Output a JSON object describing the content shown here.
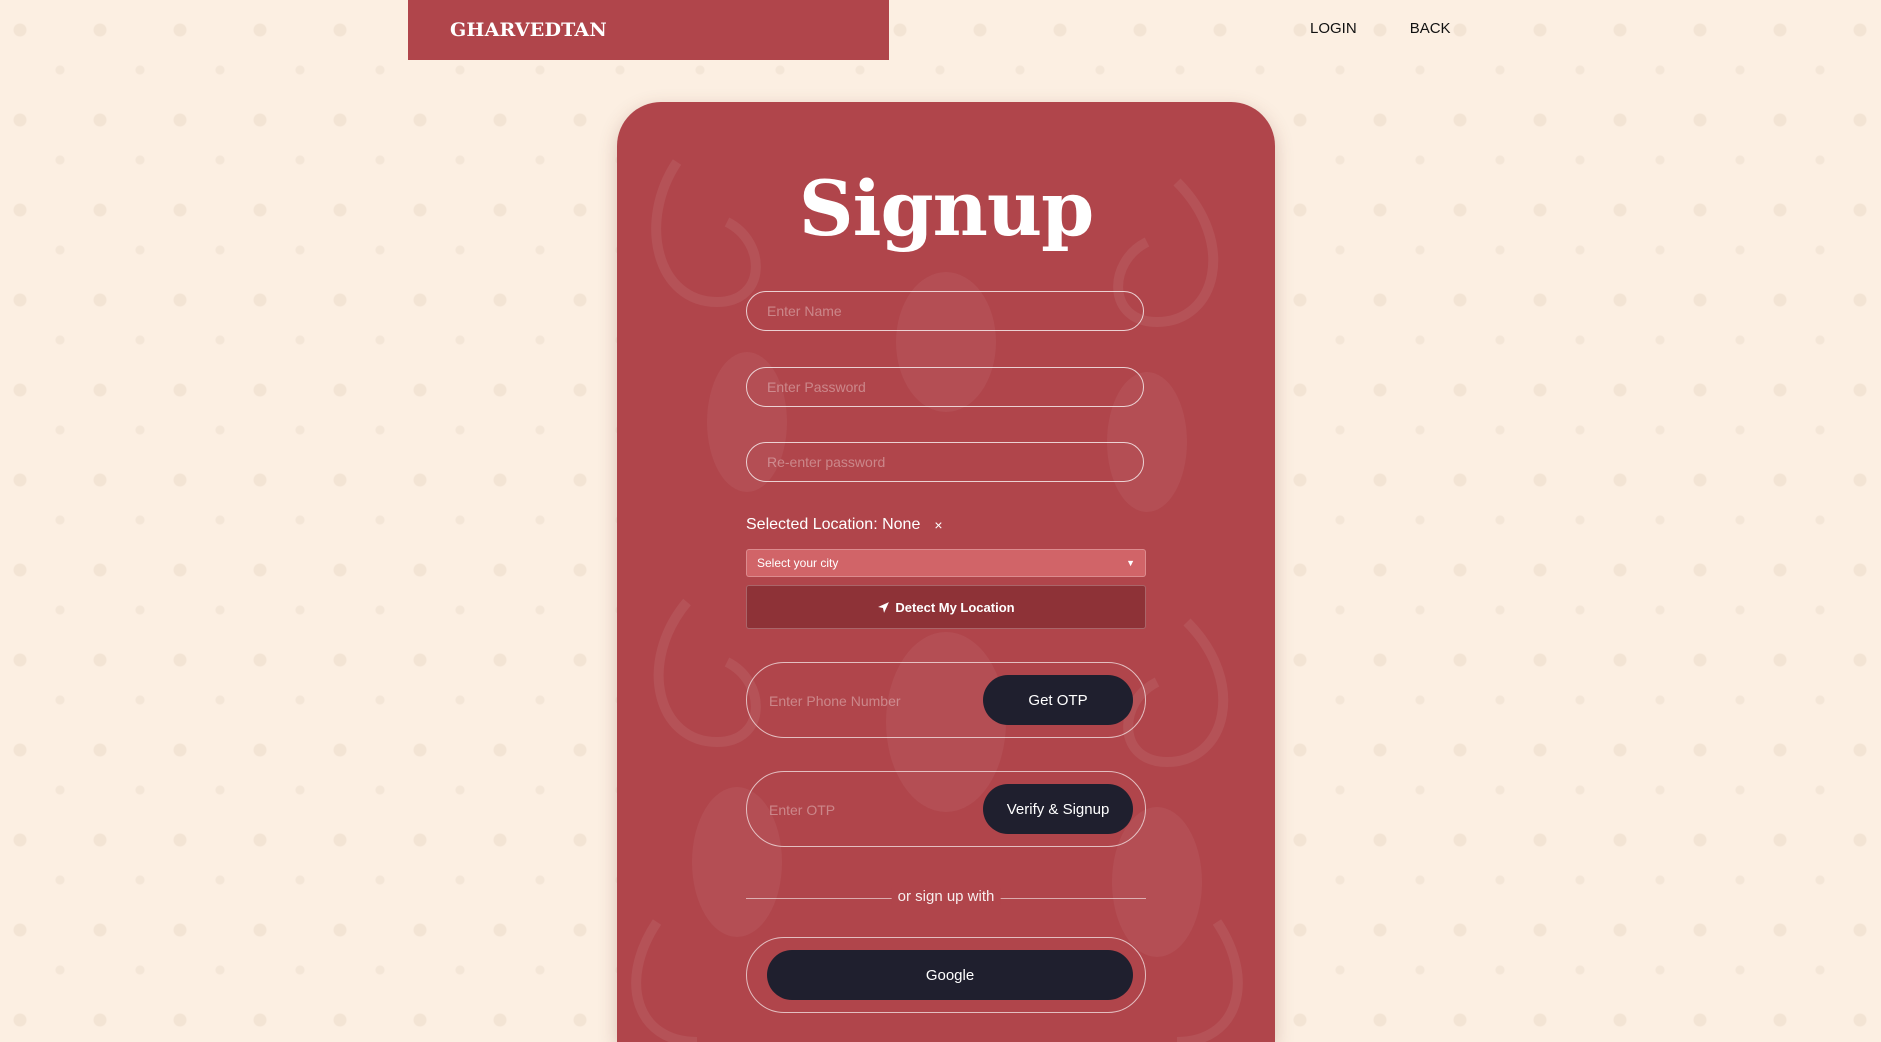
{
  "brand": {
    "name": "GHARVEDTAN"
  },
  "nav": {
    "login": "LOGIN",
    "back": "BACK"
  },
  "form": {
    "title": "Signup",
    "name_placeholder": "Enter Name",
    "password_placeholder": "Enter Password",
    "reenter_placeholder": "Re-enter password",
    "selected_location": "Selected Location: None",
    "clear_symbol": "×",
    "city_select": "Select your city",
    "detect_location": "Detect My Location",
    "phone_placeholder": "Enter Phone Number",
    "get_otp": "Get OTP",
    "otp_placeholder": "Enter OTP",
    "verify_signup": "Verify & Signup",
    "divider_text": "or sign up with",
    "google": "Google"
  },
  "colors": {
    "page_bg": "#fcefe2",
    "brand_red": "#b0454b",
    "dark_button": "#1f1f2e",
    "select_bg": "#d16468",
    "detect_bg": "#8e3237"
  }
}
